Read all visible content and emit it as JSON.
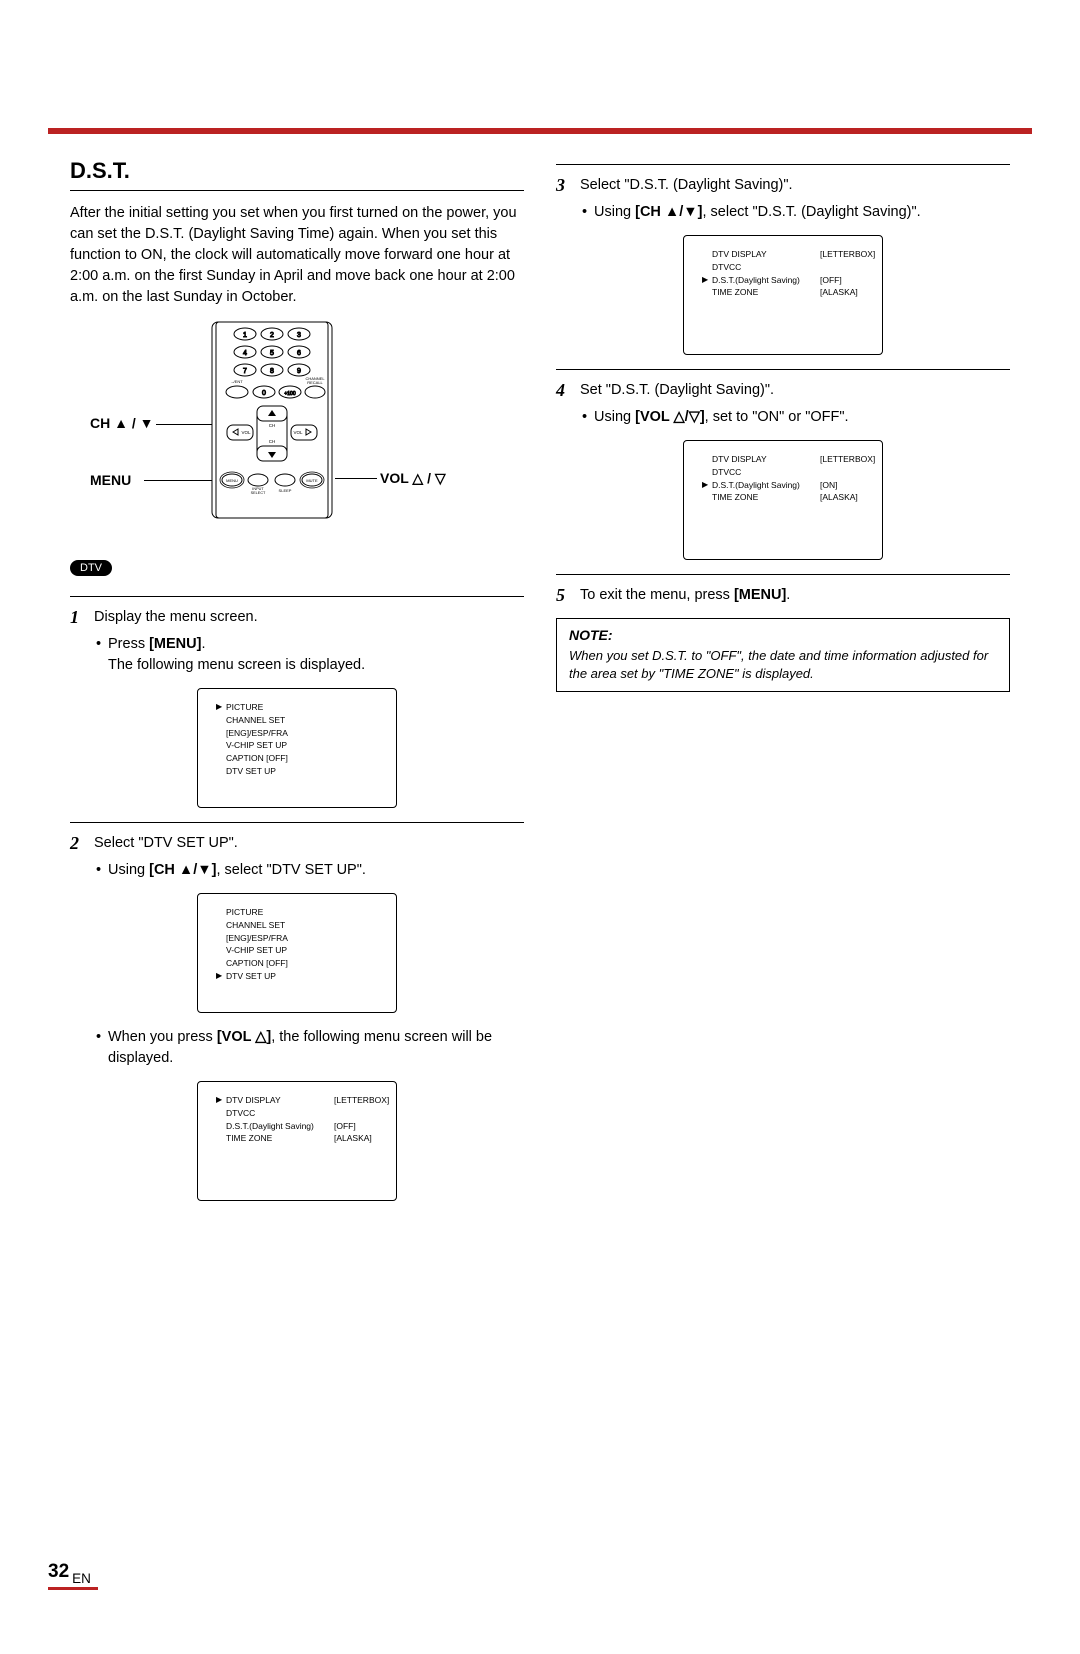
{
  "section": {
    "title": "D.S.T."
  },
  "intro": "After the initial setting you set when you first turned on the power, you can set the D.S.T. (Daylight Saving Time) again. When you set this function to ON, the clock will automatically move forward one hour at 2:00 a.m. on the first Sunday in April and move back one hour at 2:00 a.m. on the last Sunday in October.",
  "remote": {
    "labels": {
      "ch": "CH ▲ / ▼",
      "menu": "MENU",
      "vol": "VOL △ / ▽"
    },
    "keys": [
      "1",
      "2",
      "3",
      "4",
      "5",
      "6",
      "7",
      "8",
      "9",
      "0",
      "–/ENT",
      "+100",
      "CHANNEL RECALL",
      "CH",
      "VOL",
      "MENU",
      "INPUT SELECT",
      "SLEEP",
      "MUTE"
    ]
  },
  "dtv_badge": "DTV",
  "steps": {
    "s1": {
      "num": "1",
      "text": "Display the menu screen.",
      "b1_pre": "Press ",
      "b1_key": "[MENU]",
      "b1_post": ".",
      "after": "The following menu screen is displayed."
    },
    "s2": {
      "num": "2",
      "text": "Select \"DTV SET UP\".",
      "b1_pre": "Using ",
      "b1_key": "[CH ▲/▼]",
      "b1_post": ", select \"DTV SET UP\".",
      "after_pre": "When you press ",
      "after_key": "[VOL △]",
      "after_post": ", the following menu screen will be displayed."
    },
    "s3": {
      "num": "3",
      "text": "Select \"D.S.T. (Daylight Saving)\".",
      "b1_pre": "Using ",
      "b1_key": "[CH ▲/▼]",
      "b1_post": ", select \"D.S.T. (Daylight Saving)\"."
    },
    "s4": {
      "num": "4",
      "text": "Set \"D.S.T. (Daylight Saving)\".",
      "b1_pre": "Using ",
      "b1_key": "[VOL △/▽]",
      "b1_post": ", set to \"ON\" or \"OFF\"."
    },
    "s5": {
      "num": "5",
      "text_pre": "To exit the menu, press ",
      "text_key": "[MENU]",
      "text_post": "."
    }
  },
  "menu1": {
    "lines": [
      {
        "ptr": "▶",
        "l": "PICTURE",
        "r": ""
      },
      {
        "ptr": "",
        "l": "CHANNEL SET",
        "r": ""
      },
      {
        "ptr": "",
        "l": "[ENG]/ESP/FRA",
        "r": ""
      },
      {
        "ptr": "",
        "l": "V-CHIP SET UP",
        "r": ""
      },
      {
        "ptr": "",
        "l": "CAPTION [OFF]",
        "r": ""
      },
      {
        "ptr": "",
        "l": "DTV SET UP",
        "r": ""
      }
    ]
  },
  "menu2": {
    "lines": [
      {
        "ptr": "",
        "l": "PICTURE",
        "r": ""
      },
      {
        "ptr": "",
        "l": "CHANNEL SET",
        "r": ""
      },
      {
        "ptr": "",
        "l": "[ENG]/ESP/FRA",
        "r": ""
      },
      {
        "ptr": "",
        "l": "V-CHIP SET UP",
        "r": ""
      },
      {
        "ptr": "",
        "l": "CAPTION [OFF]",
        "r": ""
      },
      {
        "ptr": "▶",
        "l": "DTV SET UP",
        "r": ""
      }
    ]
  },
  "menu3": {
    "lines": [
      {
        "ptr": "▶",
        "l": "DTV DISPLAY",
        "r": "[LETTERBOX]"
      },
      {
        "ptr": "",
        "l": "DTVCC",
        "r": ""
      },
      {
        "ptr": "",
        "l": "D.S.T.(Daylight Saving)",
        "r": "[OFF]"
      },
      {
        "ptr": "",
        "l": "TIME ZONE",
        "r": "[ALASKA]"
      }
    ]
  },
  "menu4": {
    "lines": [
      {
        "ptr": "",
        "l": "DTV DISPLAY",
        "r": "[LETTERBOX]"
      },
      {
        "ptr": "",
        "l": "DTVCC",
        "r": ""
      },
      {
        "ptr": "▶",
        "l": "D.S.T.(Daylight Saving)",
        "r": "[OFF]"
      },
      {
        "ptr": "",
        "l": "TIME ZONE",
        "r": "[ALASKA]"
      }
    ]
  },
  "menu5": {
    "lines": [
      {
        "ptr": "",
        "l": "DTV DISPLAY",
        "r": "[LETTERBOX]"
      },
      {
        "ptr": "",
        "l": "DTVCC",
        "r": ""
      },
      {
        "ptr": "▶",
        "l": "D.S.T.(Daylight Saving)",
        "r": "[ON]"
      },
      {
        "ptr": "",
        "l": "TIME ZONE",
        "r": "[ALASKA]"
      }
    ]
  },
  "note": {
    "title": "NOTE:",
    "text": "When you set D.S.T. to \"OFF\", the date and time information adjusted for the area set by \"TIME ZONE\" is displayed."
  },
  "page": {
    "num": "32",
    "lang": "EN"
  }
}
